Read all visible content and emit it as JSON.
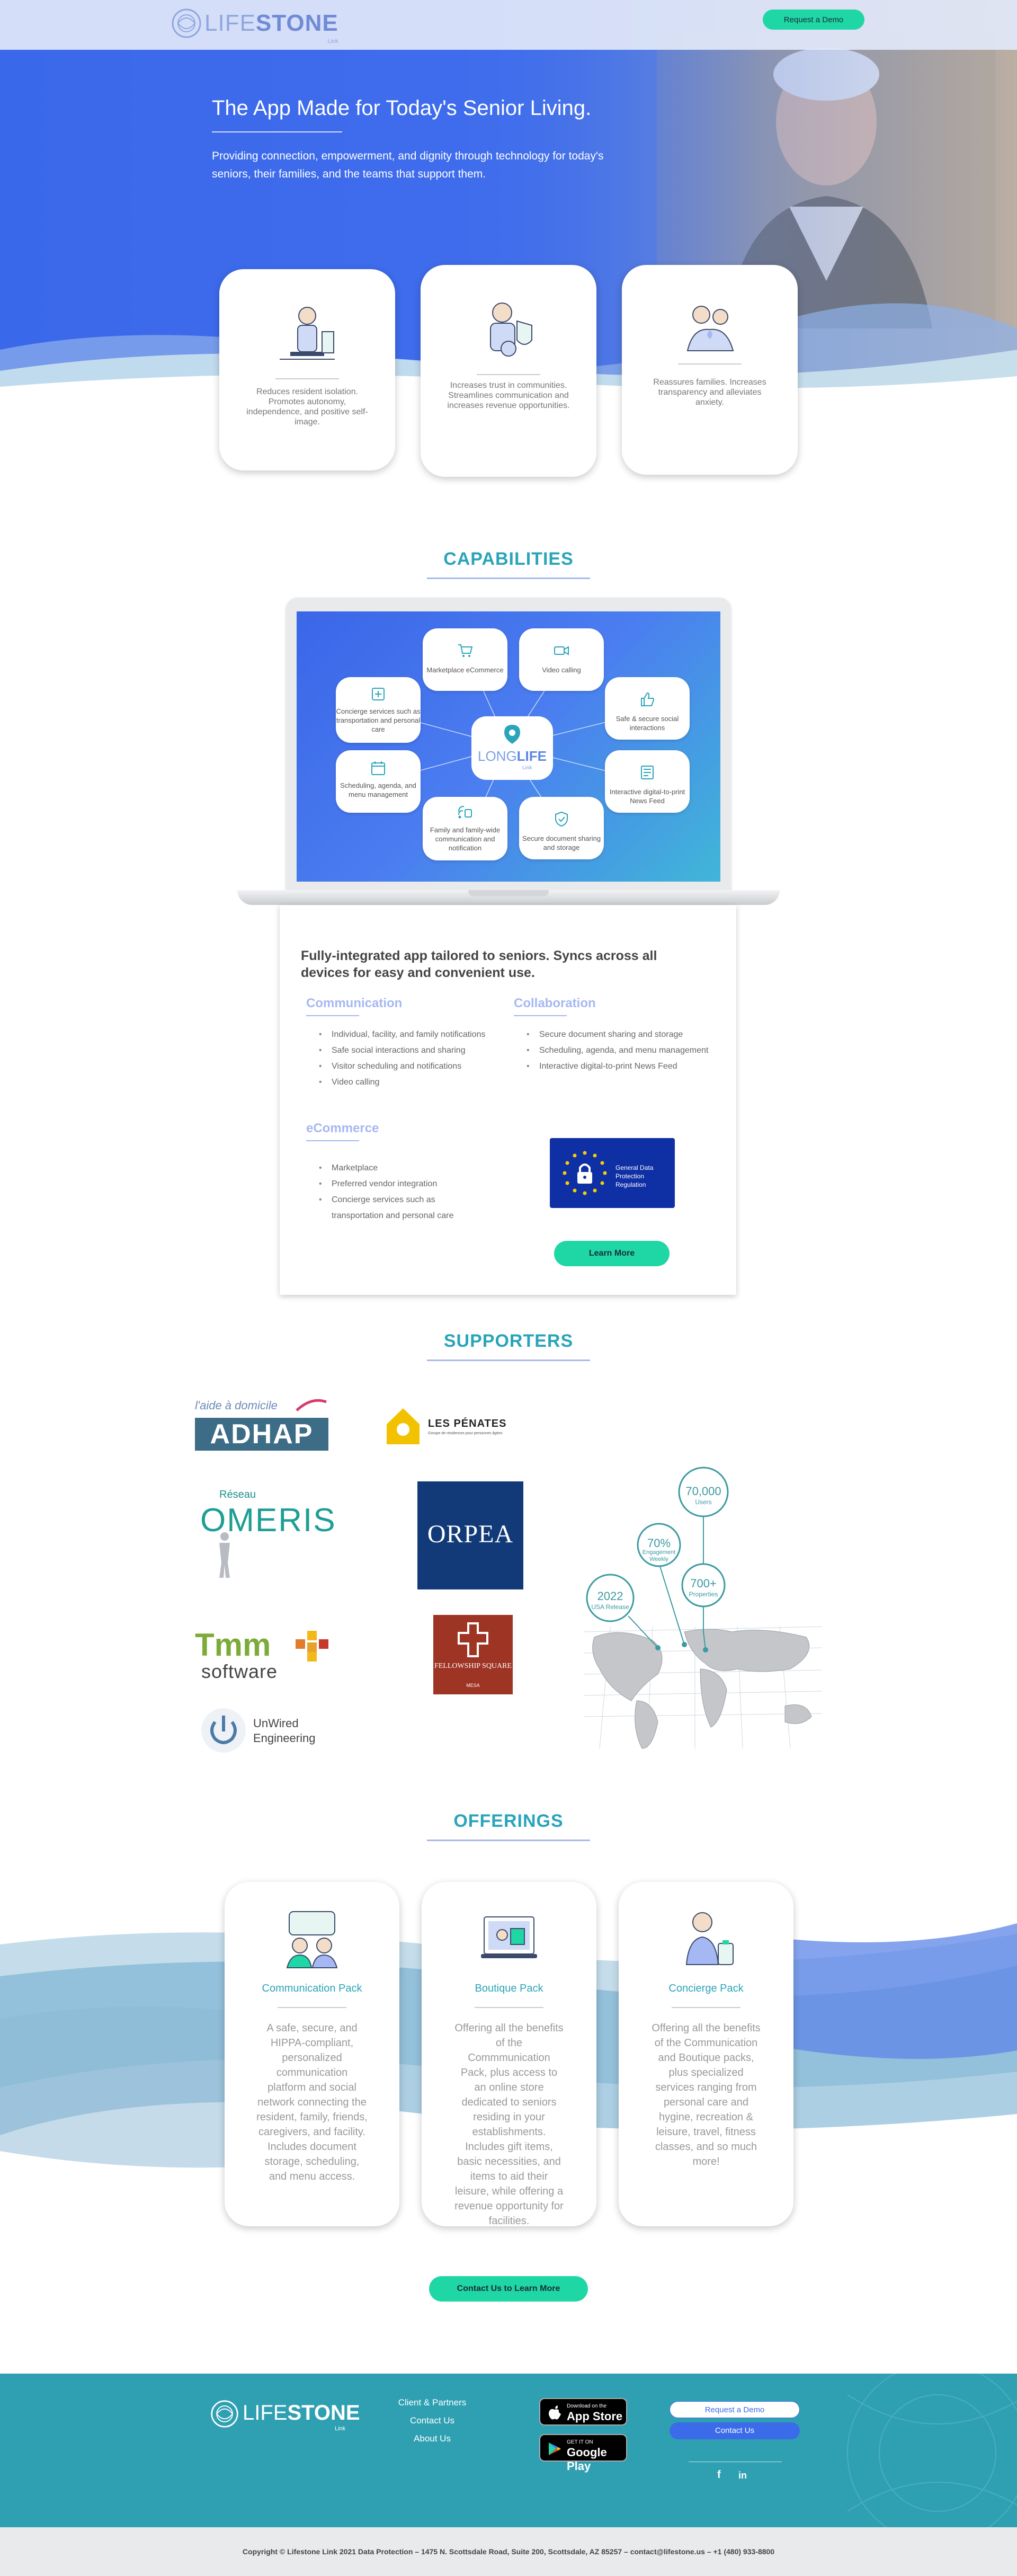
{
  "nav": {
    "logo_text": "LIFE",
    "logo_bold": "STONE",
    "logo_sub": "Link",
    "demo_button": "Request a Demo"
  },
  "hero": {
    "title": "The App Made for Today's Senior Living.",
    "text": "Providing connection, empowerment, and dignity through technology for today's seniors, their families, and the teams that support them."
  },
  "benefits": [
    {
      "text": "Reduces resident isolation. Promotes autonomy, independence, and positive self-image."
    },
    {
      "text": "Increases trust in communities. Streamlines communication and increases revenue opportunities."
    },
    {
      "text": "Reassures families. Increases transparency and alleviates anxiety."
    }
  ],
  "capabilities": {
    "title": "CAPABILITIES",
    "center_logo": "LONG",
    "center_logo_bold": "LIFE",
    "center_logo_sub": "Link",
    "nodes": [
      "Marketplace eCommerce",
      "Video calling",
      "Concierge services such as transportation and personal care",
      "Safe & secure social interactions",
      "Scheduling, agenda, and menu management",
      "Interactive digital-to-print News Feed",
      "Family and family-wide communication and notification",
      "Secure document sharing and storage"
    ]
  },
  "features": {
    "heading": "Fully-integrated app tailored to seniors. Syncs across all devices for easy and convenient use.",
    "communication": {
      "title": "Communication",
      "items": [
        "Individual, facility, and family notifications",
        "Safe social interactions and sharing",
        "Visitor scheduling and notifications",
        "Video calling"
      ]
    },
    "collaboration": {
      "title": "Collaboration",
      "items": [
        "Secure document sharing and storage",
        "Scheduling, agenda, and menu management",
        "Interactive digital-to-print News Feed"
      ]
    },
    "ecommerce": {
      "title": "eCommerce",
      "items": [
        "Marketplace",
        "Preferred vendor integration",
        "Concierge services such as transportation and personal care"
      ]
    },
    "gdpr_text": "General Data Protection Regulation",
    "learn_more": "Learn More"
  },
  "supporters": {
    "title": "SUPPORTERS",
    "adhap_tagline": "l'aide à domicile",
    "adhap": "ADHAP",
    "penates": "LES PÉNATES",
    "penates_sub": "Groupe de résidences pour personnes âgées",
    "omeris_top": "Réseau",
    "omeris": "OMERIS",
    "orpea": "ORPEA",
    "tmm": "Tmm",
    "tmm_sub": "software",
    "fellowship": "FELLOWSHIP SQUARE",
    "fellowship_sub": "MESA",
    "unwired": "UnWired",
    "unwired_sub": "Engineering",
    "stats": [
      {
        "value": "70,000",
        "label": "Users"
      },
      {
        "value": "70%",
        "label": "Engagement Weekly"
      },
      {
        "value": "2022",
        "label": "USA Release"
      },
      {
        "value": "700+",
        "label": "Properties"
      }
    ]
  },
  "offerings": {
    "title": "OFFERINGS",
    "packs": [
      {
        "name": "Communication Pack",
        "text": "A safe, secure, and HIPPA-compliant, personalized communication platform and social network connecting the resident, family, friends, caregivers, and facility. Includes document storage, scheduling, and menu access."
      },
      {
        "name": "Boutique Pack",
        "text": "Offering all the benefits of the Commmunication Pack, plus access to an online store dedicated to seniors residing in your establishments. Includes gift items, basic necessities, and items to aid their leisure, while offering a revenue opportunity for facilities."
      },
      {
        "name": "Concierge Pack",
        "text": "Offering all the benefits of the Communication and Boutique packs, plus specialized services ranging from personal care and hygine, recreation & leisure, travel, fitness classes, and so much more!"
      }
    ],
    "contact_button": "Contact Us to Learn More"
  },
  "footer": {
    "logo_text": "LIFE",
    "logo_bold": "STONE",
    "logo_sub": "Link",
    "links": [
      "Client & Partners",
      "Contact Us",
      "About Us"
    ],
    "appstore_small": "Download on the",
    "appstore_big": "App Store",
    "googleplay_small": "GET IT ON",
    "googleplay_big": "Google Play",
    "demo_button": "Request a Demo",
    "contact_button": "Contact Us",
    "social_f": "f",
    "social_in": "in",
    "copyright": "Copyright © Lifestone Link 2021 Data Protection – 1475 N. Scottsdale Road, Suite 200, Scottsdale, AZ 85257 – contact@lifestone.us – +1 (480) 933-8800"
  },
  "colors": {
    "brand_blue": "#3c6bea",
    "teal": "#2aa4ba",
    "green": "#1fd6a5",
    "periwinkle": "#a6b8f3"
  }
}
